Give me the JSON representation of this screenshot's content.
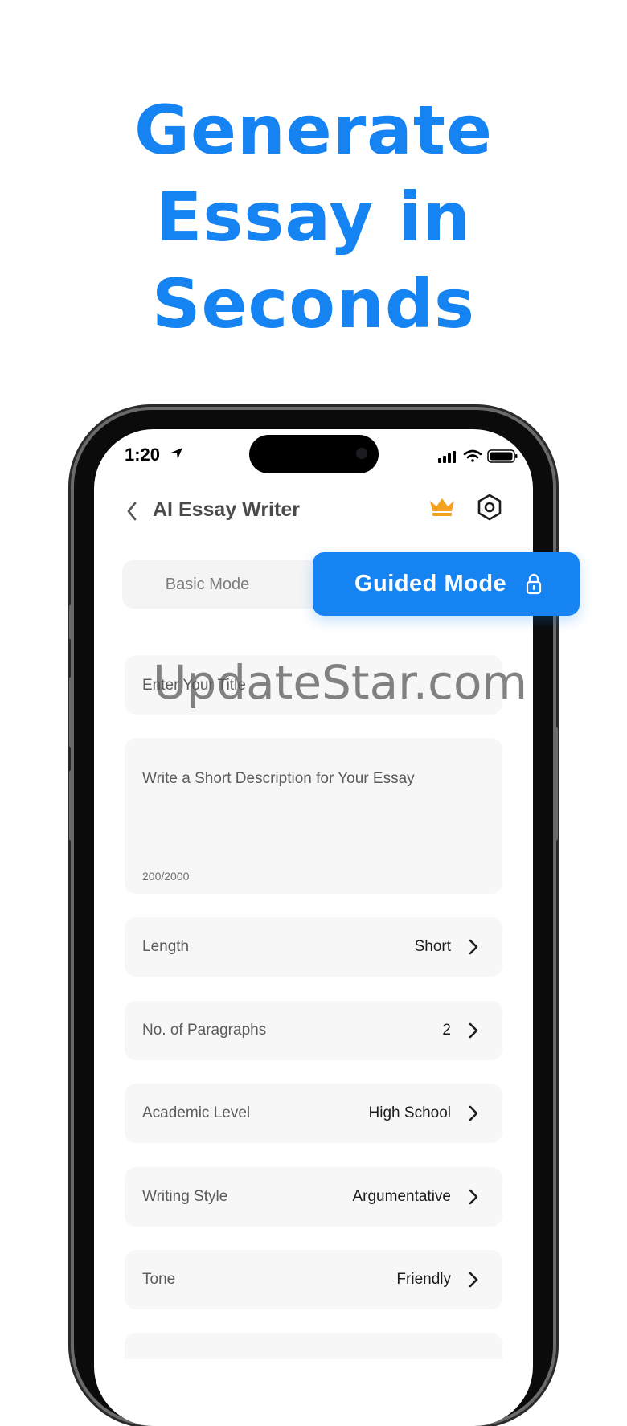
{
  "headline": [
    "Generate",
    "Essay in",
    "Seconds"
  ],
  "status_bar": {
    "time": "1:20"
  },
  "nav": {
    "title": "AI Essay Writer"
  },
  "mode_toggle": {
    "basic_label": "Basic Mode",
    "guided_label": "Guided Mode",
    "selected": "Guided Mode"
  },
  "title_field": {
    "placeholder": "Enter Your Title"
  },
  "description_field": {
    "placeholder": "Write a Short Description for Your Essay",
    "counter": "200/2000"
  },
  "watermark": "UpdateStar.com",
  "settings": [
    {
      "label": "Length",
      "value": "Short"
    },
    {
      "label": "No. of Paragraphs",
      "value": "2"
    },
    {
      "label": "Academic Level",
      "value": "High School"
    },
    {
      "label": "Writing Style",
      "value": "Argumentative"
    },
    {
      "label": "Tone",
      "value": "Friendly"
    }
  ],
  "colors": {
    "accent": "#1683F2",
    "crown": "#F2A21E",
    "field_bg": "#F7F7F7"
  }
}
